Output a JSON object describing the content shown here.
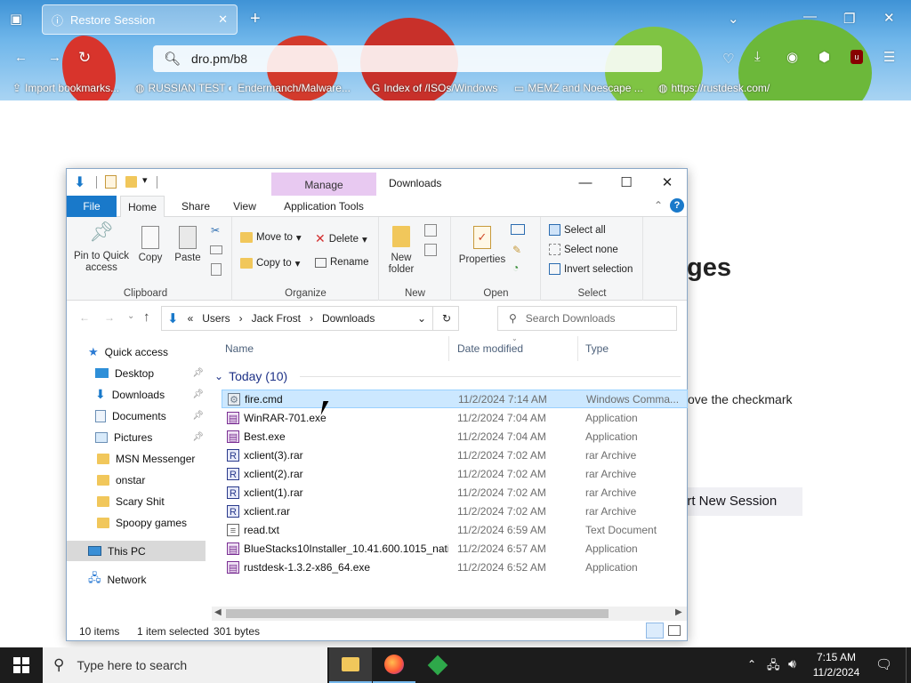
{
  "browser": {
    "tab_title": "Restore Session",
    "url": "dro.pm/b8",
    "bookmarks": [
      {
        "label": "Import bookmarks..."
      },
      {
        "label": "RUSSIAN TEST"
      },
      {
        "label": "Endermanch/Malware..."
      },
      {
        "label": "Index of /ISOs/Windows"
      },
      {
        "label": "MEMZ and Noescape ..."
      },
      {
        "label": "https://rustdesk.com/"
      }
    ]
  },
  "page": {
    "heading_fragment": "ges",
    "checkmark_text": "ove the checkmark",
    "start_button": "art New Session"
  },
  "explorer": {
    "window_title": "Downloads",
    "manage_label": "Manage",
    "tabs": {
      "file": "File",
      "home": "Home",
      "share": "Share",
      "view": "View",
      "app_tools": "Application Tools"
    },
    "ribbon": {
      "clipboard": {
        "label": "Clipboard",
        "pin": "Pin to Quick access",
        "copy": "Copy",
        "paste": "Paste"
      },
      "organize": {
        "label": "Organize",
        "move_to": "Move to",
        "copy_to": "Copy to",
        "delete": "Delete",
        "rename": "Rename"
      },
      "new": {
        "label": "New",
        "new_folder": "New folder"
      },
      "open": {
        "label": "Open",
        "properties": "Properties"
      },
      "select": {
        "label": "Select",
        "select_all": "Select all",
        "select_none": "Select none",
        "invert": "Invert selection"
      }
    },
    "breadcrumb": [
      "Users",
      "Jack Frost",
      "Downloads"
    ],
    "search_placeholder": "Search Downloads",
    "nav": {
      "quick_access": "Quick access",
      "items": [
        {
          "label": "Desktop",
          "pinned": true
        },
        {
          "label": "Downloads",
          "pinned": true
        },
        {
          "label": "Documents",
          "pinned": true
        },
        {
          "label": "Pictures",
          "pinned": true
        },
        {
          "label": "MSN Messenger"
        },
        {
          "label": "onstar"
        },
        {
          "label": "Scary Shit"
        },
        {
          "label": "Spoopy games"
        }
      ],
      "this_pc": "This PC",
      "network": "Network"
    },
    "columns": {
      "name": "Name",
      "date": "Date modified",
      "type": "Type"
    },
    "group": "Today (10)",
    "files": [
      {
        "name": "fire.cmd",
        "date": "11/2/2024 7:14 AM",
        "type": "Windows Comma...",
        "selected": true
      },
      {
        "name": "WinRAR-701.exe",
        "date": "11/2/2024 7:04 AM",
        "type": "Application"
      },
      {
        "name": "Best.exe",
        "date": "11/2/2024 7:04 AM",
        "type": "Application"
      },
      {
        "name": "xclient(3).rar",
        "date": "11/2/2024 7:02 AM",
        "type": "rar Archive"
      },
      {
        "name": "xclient(2).rar",
        "date": "11/2/2024 7:02 AM",
        "type": "rar Archive"
      },
      {
        "name": "xclient(1).rar",
        "date": "11/2/2024 7:02 AM",
        "type": "rar Archive"
      },
      {
        "name": "xclient.rar",
        "date": "11/2/2024 7:02 AM",
        "type": "rar Archive"
      },
      {
        "name": "read.txt",
        "date": "11/2/2024 6:59 AM",
        "type": "Text Document"
      },
      {
        "name": "BlueStacks10Installer_10.41.600.1015_nati...",
        "date": "11/2/2024 6:57 AM",
        "type": "Application"
      },
      {
        "name": "rustdesk-1.3.2-x86_64.exe",
        "date": "11/2/2024 6:52 AM",
        "type": "Application"
      }
    ],
    "status": {
      "items": "10 items",
      "selected": "1 item selected",
      "size": "301 bytes"
    }
  },
  "taskbar": {
    "search_placeholder": "Type here to search",
    "time": "7:15 AM",
    "date": "11/2/2024"
  }
}
